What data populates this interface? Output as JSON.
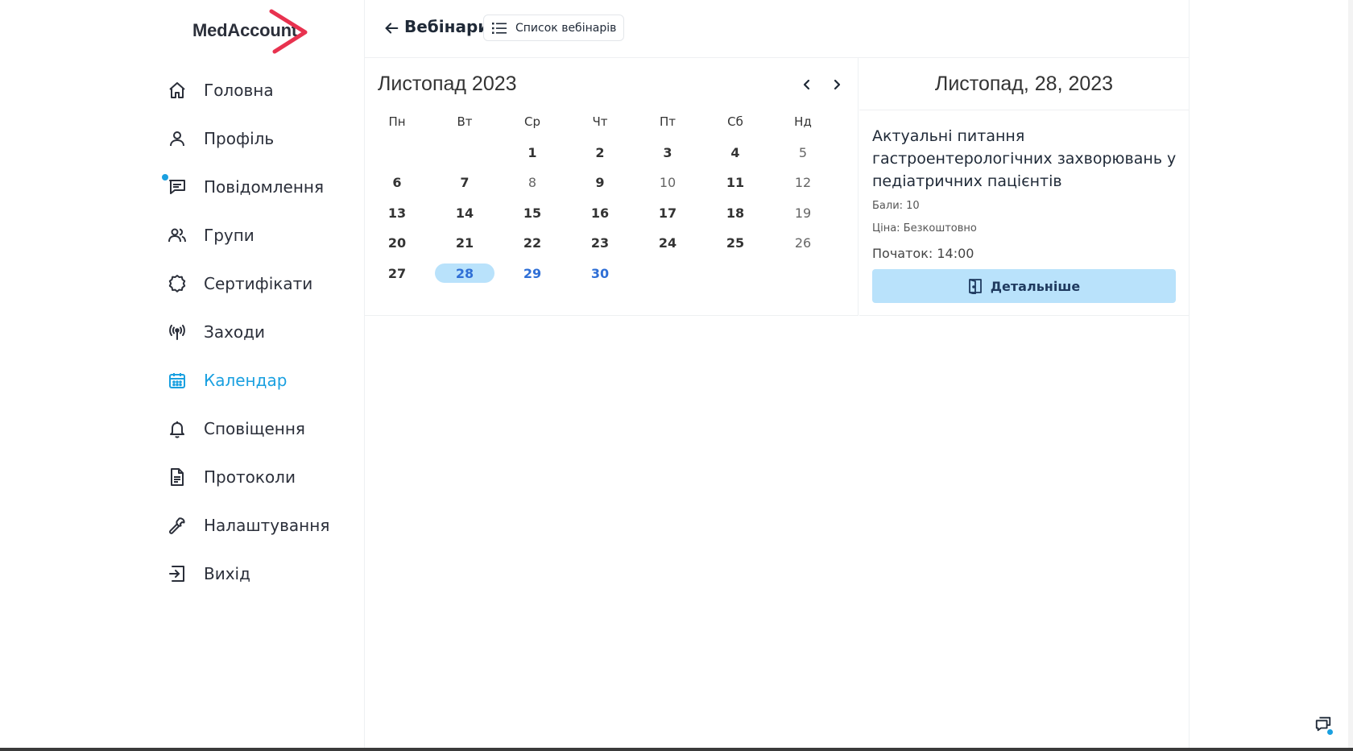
{
  "brand": {
    "name": "MedAccount",
    "accent": "#e8324f"
  },
  "sidebar": {
    "active_color": "#1aa0e0",
    "items": [
      {
        "label": "Головна",
        "icon": "home-icon",
        "active": false
      },
      {
        "label": "Профіль",
        "icon": "user-icon",
        "active": false
      },
      {
        "label": "Повідомлення",
        "icon": "message-icon",
        "active": false,
        "has_badge": true
      },
      {
        "label": "Групи",
        "icon": "users-icon",
        "active": false
      },
      {
        "label": "Сертифікати",
        "icon": "certificate-icon",
        "active": false
      },
      {
        "label": "Заходи",
        "icon": "broadcast-icon",
        "active": false
      },
      {
        "label": "Календар",
        "icon": "calendar-icon",
        "active": true
      },
      {
        "label": "Сповіщення",
        "icon": "bell-icon",
        "active": false
      },
      {
        "label": "Протоколи",
        "icon": "document-icon",
        "active": false
      },
      {
        "label": "Налаштування",
        "icon": "wrench-icon",
        "active": false
      },
      {
        "label": "Вихід",
        "icon": "logout-icon",
        "active": false
      }
    ]
  },
  "header": {
    "title": "Вебінари",
    "list_button_label": "Список вебінарів"
  },
  "calendar": {
    "month_title": "Листопад 2023",
    "weekdays": [
      "Пн",
      "Вт",
      "Ср",
      "Чт",
      "Пт",
      "Сб",
      "Нд"
    ],
    "first_weekday_index": 2,
    "days_in_month": 30,
    "bold_days": [
      1,
      2,
      3,
      4,
      6,
      7,
      9,
      11,
      13,
      14,
      15,
      16,
      17,
      18,
      20,
      21,
      22,
      23,
      24,
      25,
      27
    ],
    "highlighted_days": [
      29,
      30
    ],
    "selected_day": 28
  },
  "event_panel": {
    "date_title": "Листопад, 28, 2023",
    "title": "Актуальні питання гастроентерологічних захворювань у педіатричних пацієнтів",
    "points": "Бали: 10",
    "price": "Ціна: Безкоштовно",
    "start": "Початок: 14:00",
    "details_label": "Детальніше"
  }
}
